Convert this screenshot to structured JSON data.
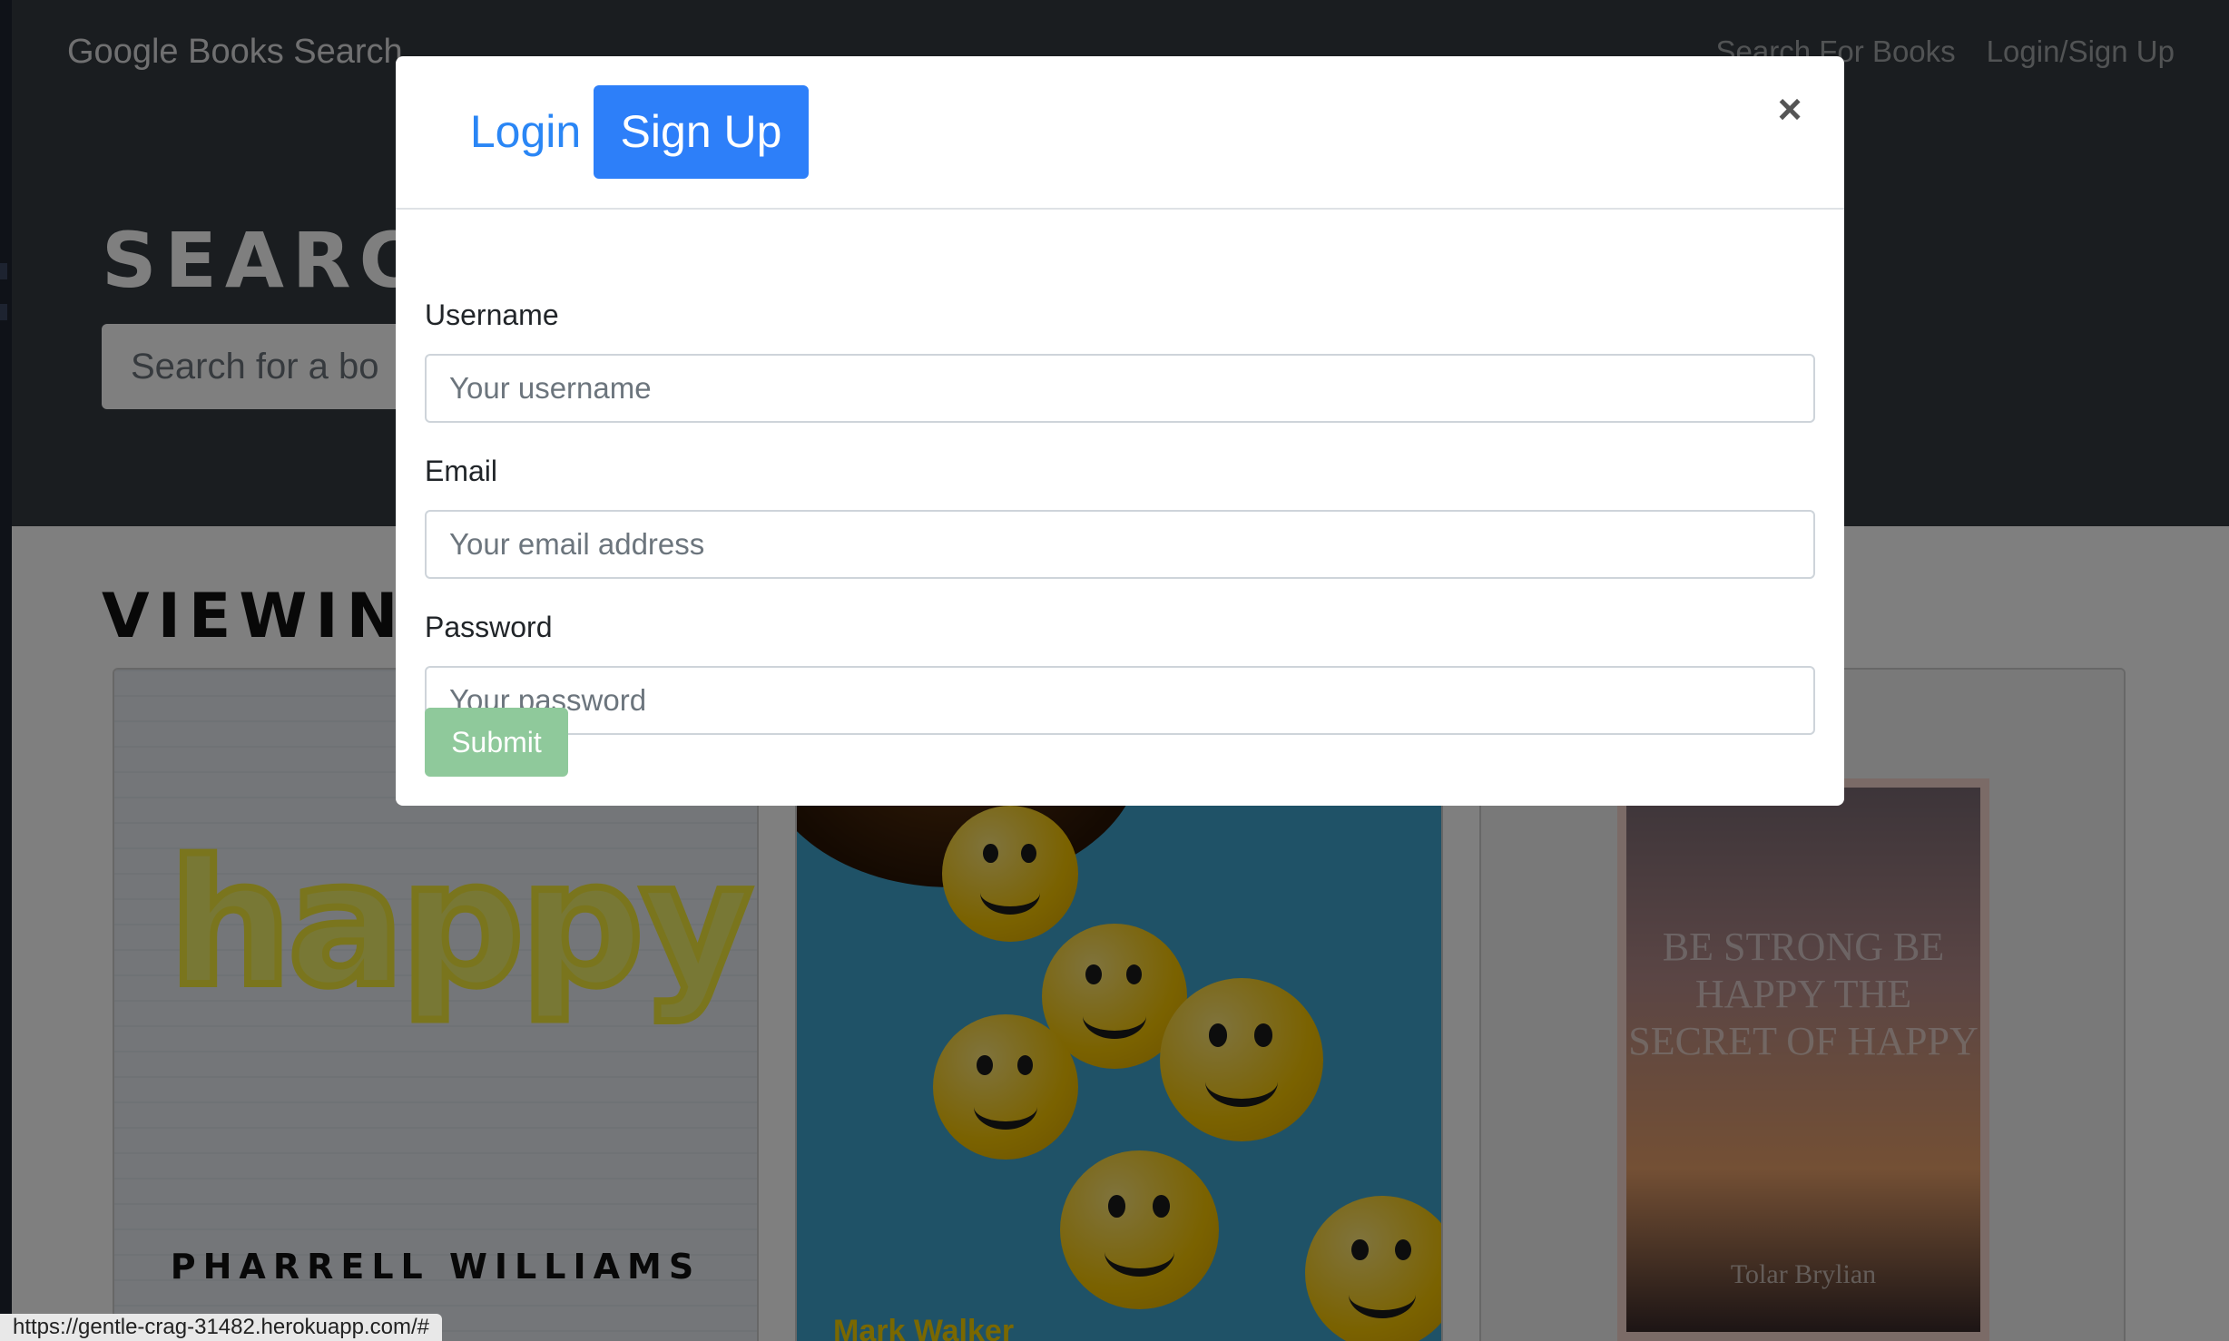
{
  "app": {
    "brand": "Google Books Search",
    "nav": [
      "Search For Books",
      "Login/Sign Up"
    ]
  },
  "hero": {
    "title": "SEARC",
    "search_placeholder": "Search for a bo"
  },
  "results": {
    "title": "VIEWIN",
    "cards": [
      {
        "cover_title": "happy!",
        "cover_author": "PHARRELL WILLIAMS"
      },
      {
        "cover_author": "Mark Walker"
      },
      {
        "cover_title": "BE STRONG BE HAPPY THE SECRET OF HAPPY",
        "cover_author": "Tolar Brylian"
      }
    ]
  },
  "status_url": "https://gentle-crag-31482.herokuapp.com/#",
  "modal": {
    "tabs": {
      "login": "Login",
      "signup": "Sign Up"
    },
    "active_tab": "signup",
    "close_icon": "close-icon",
    "close_label": "×",
    "fields": [
      {
        "label": "Username",
        "placeholder": "Your username",
        "value": ""
      },
      {
        "label": "Email",
        "placeholder": "Your email address",
        "value": ""
      },
      {
        "label": "Password",
        "placeholder": "Your password",
        "value": ""
      }
    ],
    "submit_label": "Submit",
    "colors": {
      "primary": "#2d7ff9",
      "submit_disabled": "#8fc99b"
    }
  }
}
